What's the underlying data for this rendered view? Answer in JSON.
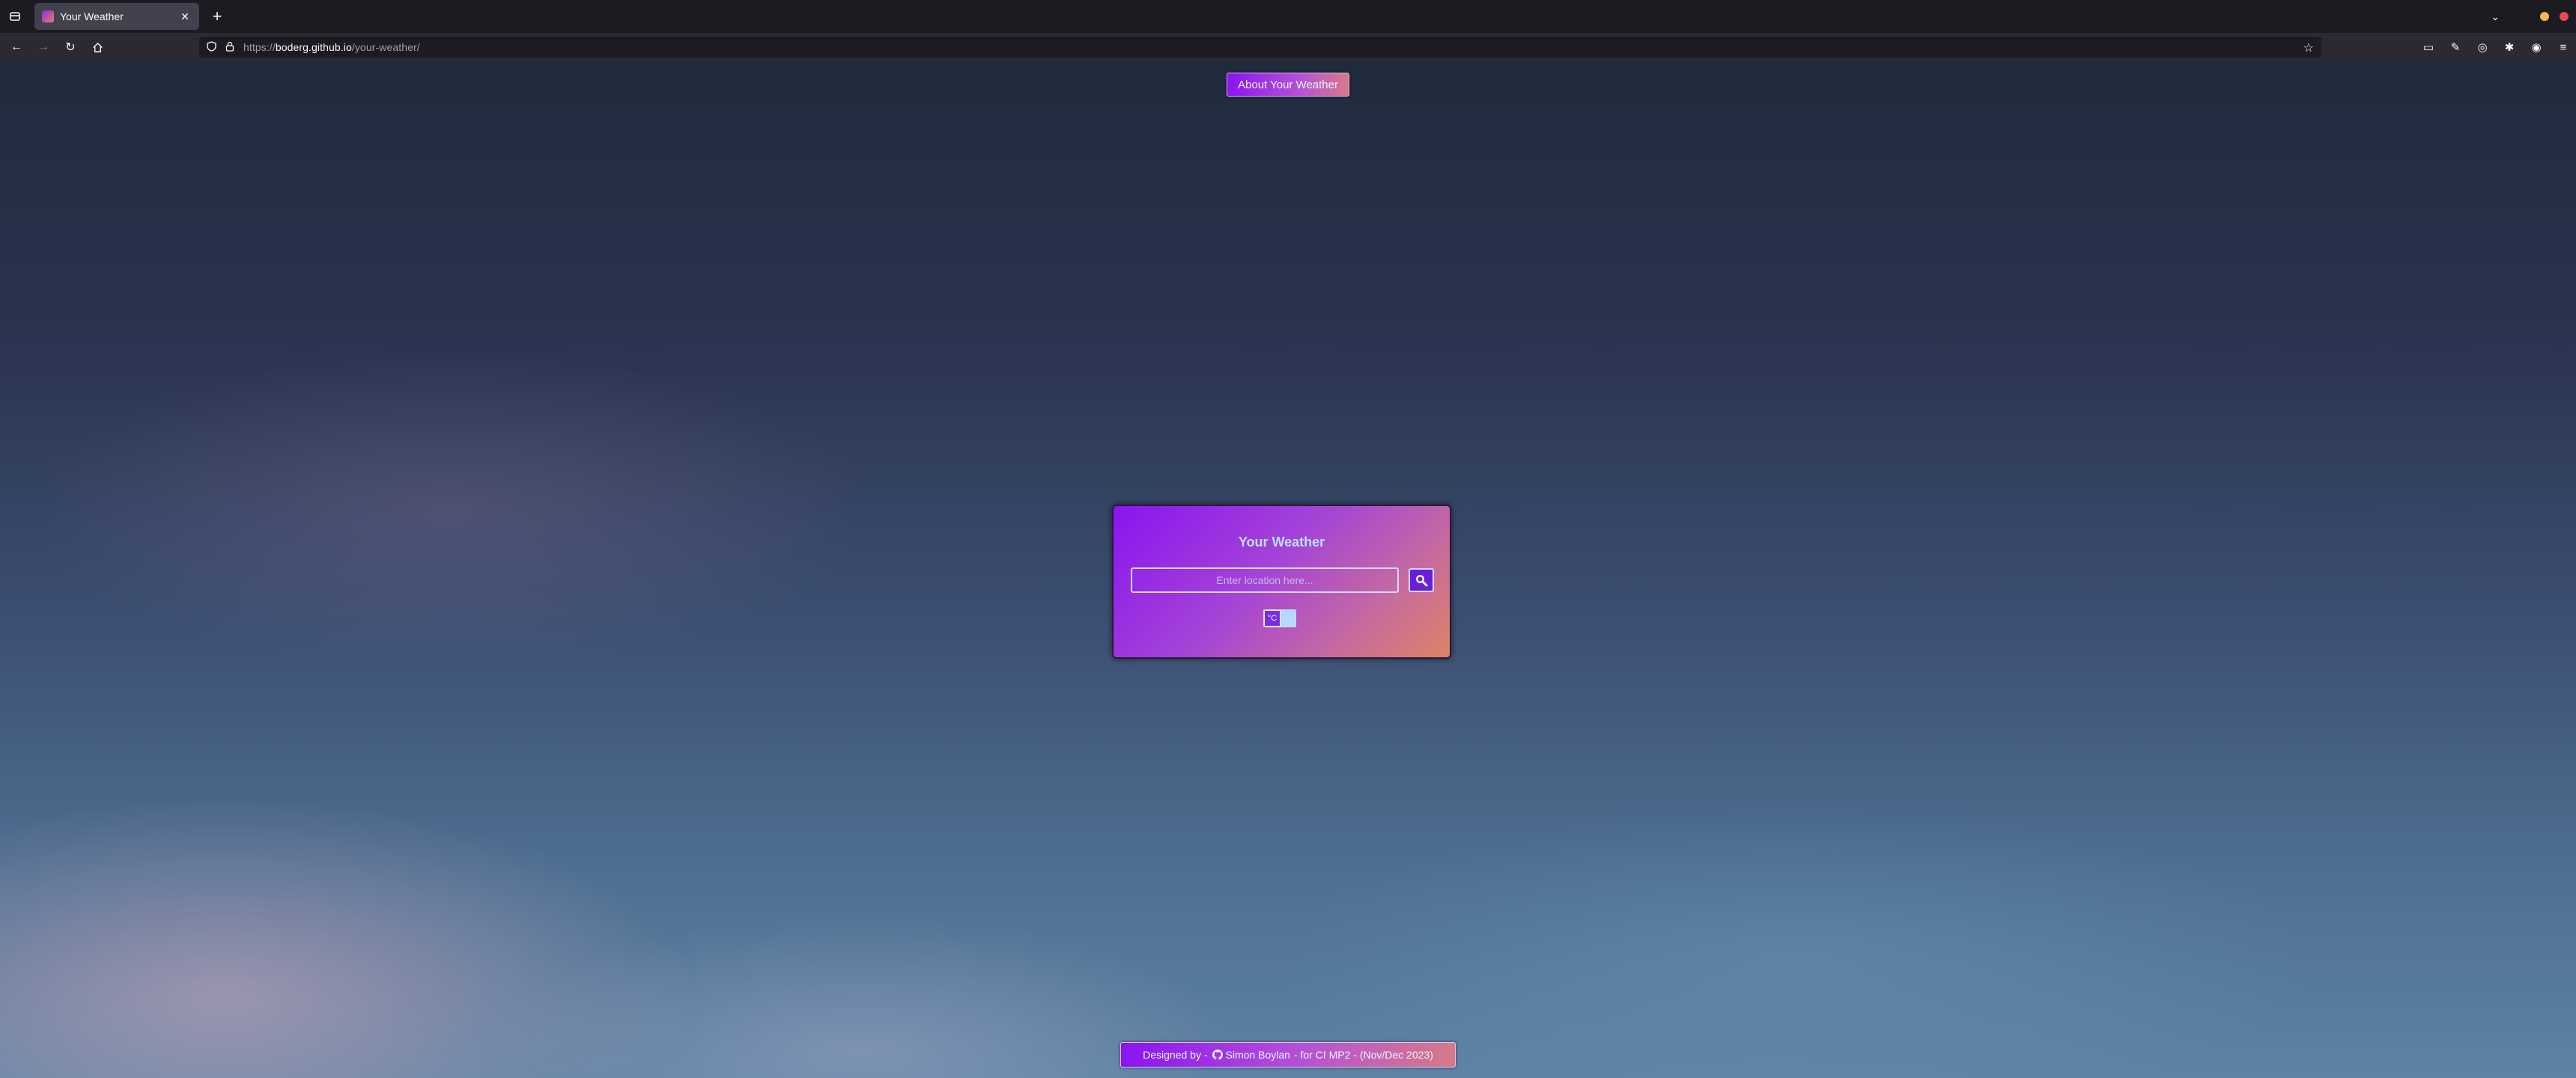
{
  "browser": {
    "tab_title": "Your Weather",
    "url_prefix": "https://",
    "url_host": "boderg.github.io",
    "url_path": "/your-weather/"
  },
  "page": {
    "about_button": "About Your Weather",
    "card_title": "Your Weather",
    "search_placeholder": "Enter location here...",
    "unit_label": "°C",
    "footer": {
      "designed_by": "Designed by -",
      "author": "Simon Boylan",
      "rest": "- for CI MP2 - (Nov/Dec 2023)"
    }
  },
  "colors": {
    "accent_start": "#8a14f0",
    "accent_end": "#dd8466"
  },
  "icons": [
    "tab-list-icon",
    "close-icon",
    "plus-icon",
    "back-icon",
    "forward-icon",
    "reload-icon",
    "home-icon",
    "shield-icon",
    "lock-icon",
    "star-icon",
    "search-icon",
    "github-icon"
  ]
}
